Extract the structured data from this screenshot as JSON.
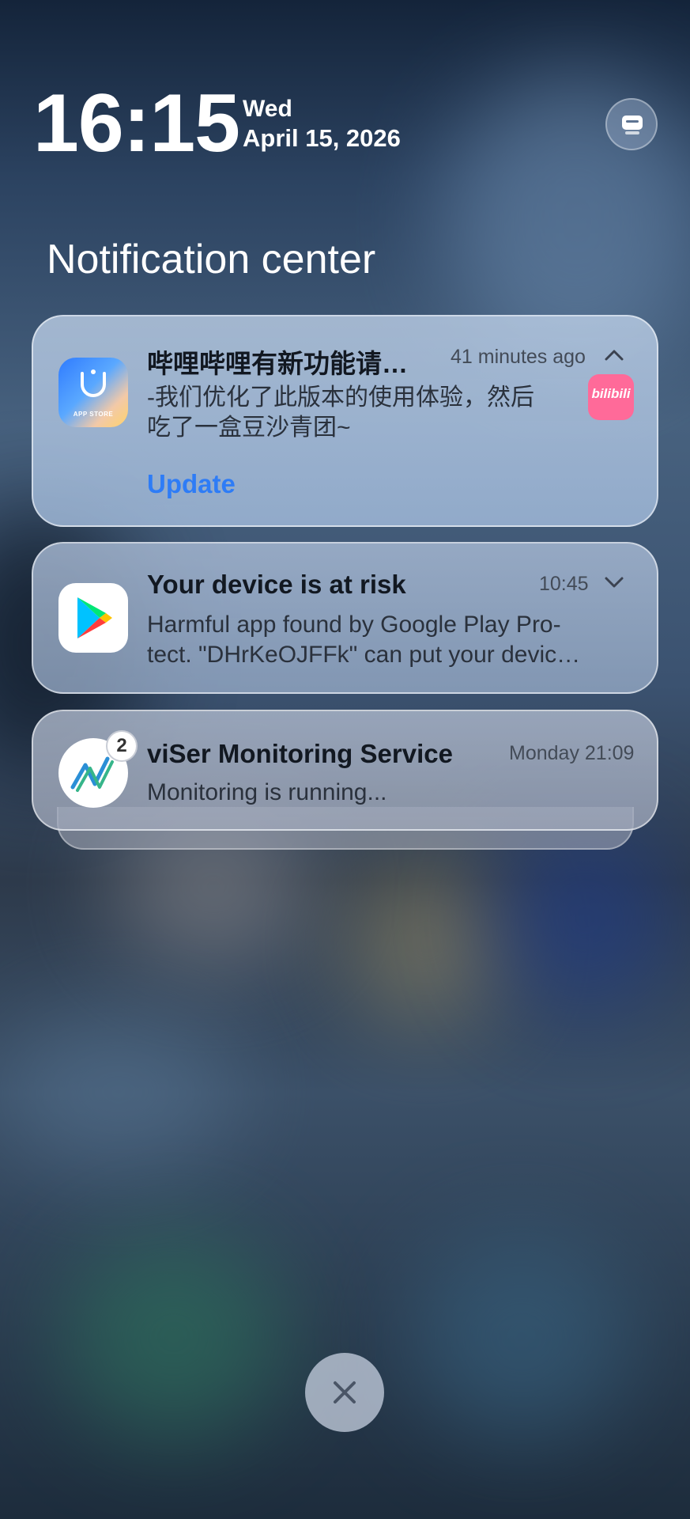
{
  "header": {
    "time": "16:15",
    "day": "Wed",
    "date": "April 15, 2026"
  },
  "notification_center": {
    "title": "Notification center"
  },
  "notifications": [
    {
      "app_icon": "app-store-icon",
      "title": "哔哩哔哩有新功能请…",
      "time": "41 minutes ago",
      "body_line1": "-我们优化了此版本的使用体验，然后",
      "body_line2": "吃了一盒豆沙青团~",
      "action": "Update",
      "thumb_icon": "bilibili-icon",
      "thumb_text": "bilibili",
      "expanded": true
    },
    {
      "app_icon": "google-play-icon",
      "title": "Your device is at risk",
      "time": "10:45",
      "body_line1": "Harmful app found by Google Play Pro-",
      "body_line2": "tect. \"DHrKeOJFFk\" can put your devic…",
      "expanded": false
    },
    {
      "app_icon": "viser-icon",
      "badge": "2",
      "title": "viSer Monitoring Service",
      "time": "Monday 21:09",
      "body_line1": "Monitoring is running..."
    }
  ],
  "app_store_icon_text": "APP STORE",
  "colors": {
    "accent": "#2e7cf6",
    "bilibili_pink": "#ff6a99"
  }
}
